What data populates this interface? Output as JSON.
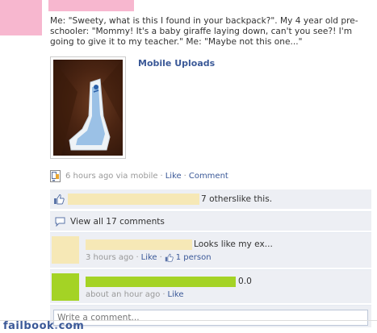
{
  "post": {
    "text": "Me: \"Sweety, what is this I found in your backpack?\". My 4 year old pre-schooler: \"Mommy! It's a baby giraffe laying down, can't you see?! I'm going to give it to my teacher.\" Me: \"Maybe not this one...\"",
    "album_label": "Mobile Uploads",
    "timestamp": "6 hours ago via mobile",
    "like_action": "Like",
    "comment_action": "Comment",
    "separator": "·"
  },
  "likes": {
    "others_link": "7 others",
    "suffix": " like this."
  },
  "comments_toggle": {
    "label": "View all 17 comments"
  },
  "comments": [
    {
      "text": "Looks like my ex...",
      "time": "3 hours ago",
      "like_label": "Like",
      "like_count": "1 person",
      "avatar_color": "#f6e8b6"
    },
    {
      "text": "0.0",
      "time": "about an hour ago",
      "like_label": "Like",
      "avatar_color": "#a4d325"
    }
  ],
  "composer": {
    "placeholder": "Write a comment..."
  },
  "watermark": {
    "brand": "failbook",
    "dot": ".",
    "tld": "com"
  },
  "colors": {
    "link": "#3b5998",
    "censor_pink": "#f7b7cf",
    "censor_yellow": "#f6e8b6",
    "censor_green": "#a4d325",
    "ufi_background": "#edeff4"
  },
  "icons": {
    "mobile": "mobile-upload-icon",
    "like": "thumbs-up-icon",
    "comments": "comment-bubble-icon"
  }
}
